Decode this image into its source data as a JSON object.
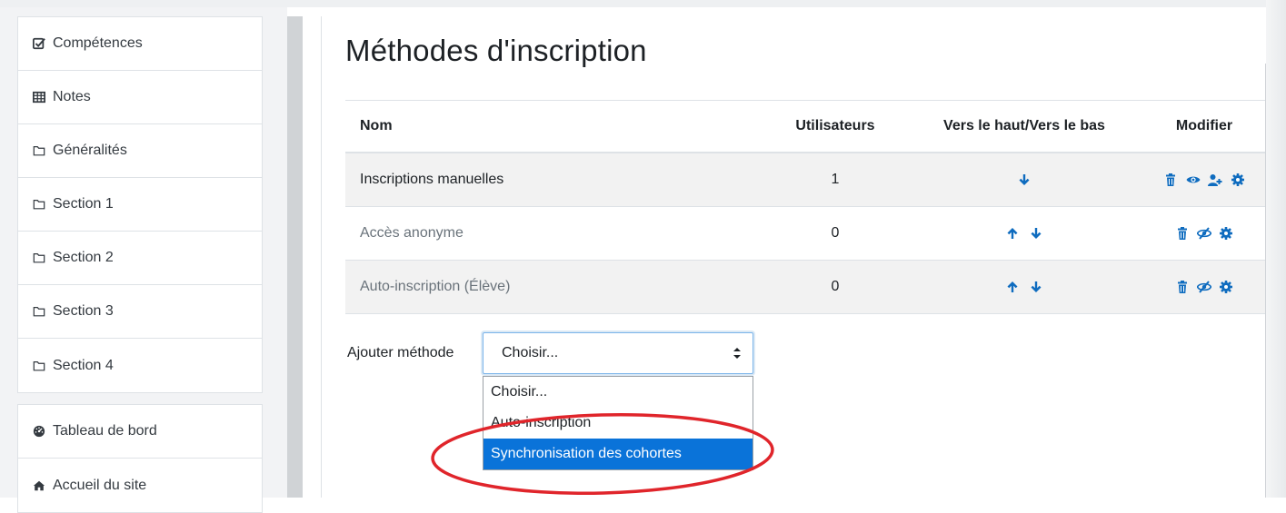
{
  "sidebar": {
    "items": [
      {
        "label": "Compétences",
        "icon": "checkbox-icon"
      },
      {
        "label": "Notes",
        "icon": "table-icon"
      },
      {
        "label": "Généralités",
        "icon": "folder-icon"
      },
      {
        "label": "Section 1",
        "icon": "folder-icon"
      },
      {
        "label": "Section 2",
        "icon": "folder-icon"
      },
      {
        "label": "Section 3",
        "icon": "folder-icon"
      },
      {
        "label": "Section 4",
        "icon": "folder-icon"
      }
    ],
    "items2": [
      {
        "label": "Tableau de bord",
        "icon": "dashboard-icon"
      },
      {
        "label": "Accueil du site",
        "icon": "home-icon"
      }
    ]
  },
  "main": {
    "title": "Méthodes d'inscription",
    "table": {
      "headers": {
        "name": "Nom",
        "users": "Utilisateurs",
        "move": "Vers le haut/Vers le bas",
        "edit": "Modifier"
      },
      "rows": [
        {
          "name": "Inscriptions manuelles",
          "users": "1",
          "active": true
        },
        {
          "name": "Accès anonyme",
          "users": "0",
          "active": false
        },
        {
          "name": "Auto-inscription (Élève)",
          "users": "0",
          "active": false
        }
      ]
    },
    "add_method": {
      "label": "Ajouter méthode",
      "selected": "Choisir...",
      "options": [
        "Choisir...",
        "Auto-inscription",
        "Synchronisation des cohortes"
      ],
      "highlighted_option": "Synchronisation des cohortes"
    }
  },
  "colors": {
    "icon_blue": "#0f6cbf",
    "option_highlight": "#0a73d9",
    "annotation_red": "#e0252b"
  }
}
